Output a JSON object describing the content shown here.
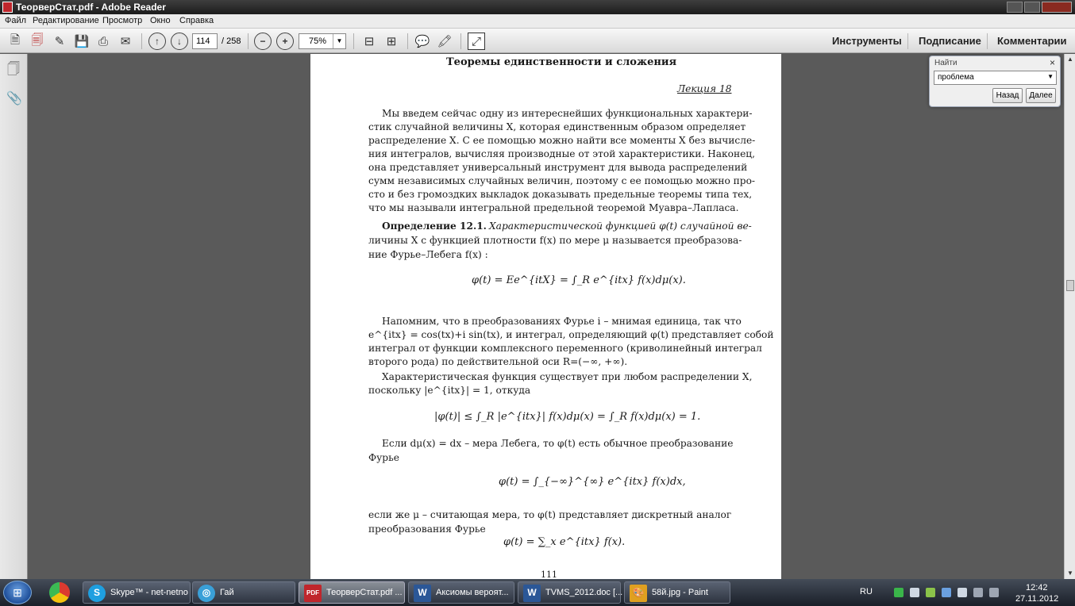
{
  "window": {
    "title": "ТеорверСтат.pdf - Adobe Reader"
  },
  "menu": [
    "Файл",
    "Редактирование",
    "Просмотр",
    "Окно",
    "Справка"
  ],
  "toolbar": {
    "page_current": "114",
    "page_total": "/ 258",
    "zoom": "75%",
    "right_links": [
      "Инструменты",
      "Подписание",
      "Комментарии"
    ]
  },
  "find": {
    "title": "Найти",
    "query": "проблема",
    "back": "Назад",
    "next": "Далее"
  },
  "document": {
    "section_title": "Теоремы единственности и сложения",
    "lecture": "Лекция 18",
    "para1": [
      "Мы введем сейчас одну из интереснейших функциональных характери-",
      "стик случайной величины X, которая единственным образом определяет",
      "распределение X. С ее помощью можно найти все моменты X без вычисле-",
      "ния интегралов, вычисляя производные от этой характеристики. Наконец,",
      "она представляет универсальный инструмент для вывода распределений",
      "сумм независимых случайных величин, поэтому с ее помощью можно про-",
      "сто и без громоздких выкладок доказывать предельные теоремы типа тех,",
      "что мы называли интегральной предельной теоремой Муавра–Лапласа."
    ],
    "definition_label": "Определение 12.1.",
    "definition_lines": [
      "Характеристической функцией φ(t) случайной ве-",
      "личины X с функцией плотности f(x) по мере μ называется преобразова-",
      "ние Фурье–Лебега f(x) :"
    ],
    "formula1": "φ(t) = Ee^{itX} = ∫_R e^{itx} f(x)dμ(x).",
    "para2": [
      "Напомним, что в преобразованиях Фурье i – мнимая единица, так что",
      "e^{itx} = cos(tx)+i sin(tx), и интеграл, определяющий φ(t) представляет собой",
      "интеграл от функции комплексного переменного (криволинейный интеграл",
      "второго рода) по действительной оси R=(−∞, +∞)."
    ],
    "para3": [
      "Характеристическая функция существует при любом распределении X,",
      "поскольку |e^{itx}| = 1, откуда"
    ],
    "formula2": "|φ(t)| ≤ ∫_R |e^{itx}| f(x)dμ(x) = ∫_R f(x)dμ(x) = 1.",
    "para4": [
      "Если dμ(x) = dx – мера Лебега, то φ(t) есть обычное преобразование",
      "Фурье"
    ],
    "formula3": "φ(t) = ∫_{−∞}^{∞} e^{itx} f(x)dx,",
    "para5": [
      "если же μ – считающая мера, то φ(t) представляет дискретный аналог",
      "преобразования Фурье"
    ],
    "formula4": "φ(t) = ∑_x e^{itx} f(x).",
    "page_number": "111"
  },
  "taskbar": {
    "tasks": [
      {
        "label": "Skype™ - net-netno",
        "icon": "S",
        "color": "#1e9fe0"
      },
      {
        "label": "Гай",
        "icon": "◎",
        "color": "#3aa0d8"
      },
      {
        "label": "ТеорверСтат.pdf ...",
        "icon": "PDF",
        "color": "#c0262c"
      },
      {
        "label": "Аксиомы вероят...",
        "icon": "W",
        "color": "#2b5797"
      },
      {
        "label": "TVMS_2012.doc [...",
        "icon": "W",
        "color": "#2b5797"
      },
      {
        "label": "58й.jpg - Paint",
        "icon": "🎨",
        "color": "#e0a020"
      }
    ],
    "language": "RU",
    "time": "12:42",
    "date": "27.11.2012"
  },
  "colors": {
    "pdf_background": "#5a5a5a",
    "taskbar": "#1a1f29"
  }
}
